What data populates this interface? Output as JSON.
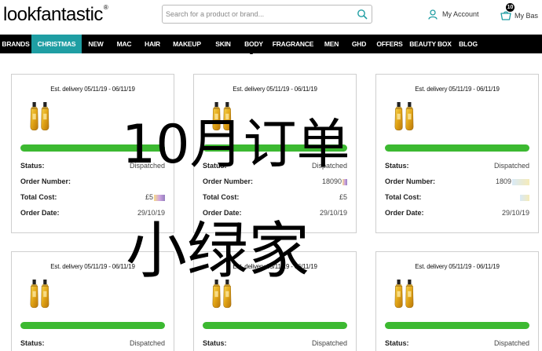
{
  "brand": {
    "logo_text": "lookfantastic",
    "logo_mark": "®"
  },
  "search": {
    "placeholder": "Search for a product or brand..."
  },
  "account": {
    "label": "My Account"
  },
  "basket": {
    "label": "My Bas",
    "count": "10"
  },
  "nav": {
    "items": [
      {
        "label": "BRANDS",
        "active": false
      },
      {
        "label": "CHRISTMAS",
        "active": true
      },
      {
        "label": "NEW",
        "active": false
      },
      {
        "label": "MAC",
        "active": false
      },
      {
        "label": "HAIR",
        "active": false
      },
      {
        "label": "MAKEUP",
        "active": false
      },
      {
        "label": "SKIN",
        "active": false
      },
      {
        "label": "BODY",
        "active": false
      },
      {
        "label": "FRAGRANCE",
        "active": false
      },
      {
        "label": "MEN",
        "active": false
      },
      {
        "label": "GHD",
        "active": false
      },
      {
        "label": "OFFERS",
        "active": false
      },
      {
        "label": "BEAUTY BOX",
        "active": false
      },
      {
        "label": "BLOG",
        "active": false
      }
    ]
  },
  "labels": {
    "status": "Status:",
    "order_number": "Order Number:",
    "total_cost": "Total Cost:",
    "order_date": "Order Date:"
  },
  "orders": [
    {
      "delivery": "Est. delivery 05/11/19 - 06/11/19",
      "status": "Dispatched",
      "order_number": "",
      "total_cost": "£5",
      "order_date": "29/10/19"
    },
    {
      "delivery": "Est. delivery 05/11/19 - 06/11/19",
      "status": "Dispatched",
      "order_number": "18090",
      "total_cost": "£5",
      "order_date": "29/10/19"
    },
    {
      "delivery": "Est. delivery 05/11/19 - 06/11/19",
      "status": "Dispatched",
      "order_number": "1809",
      "total_cost": "",
      "order_date": "29/10/19"
    },
    {
      "delivery": "Est. delivery 05/11/19 - 06/11/19",
      "status": "Dispatched"
    },
    {
      "delivery": "Est. delivery 05/11/19 - 06/11/19",
      "status": "Dispatched"
    },
    {
      "delivery": "Est. delivery 05/11/19 - 06/11/19",
      "status": "Dispatched"
    }
  ],
  "overlay": {
    "line1": "10月订单",
    "line2": "小绿家"
  },
  "colors": {
    "accent": "#1f9ea3",
    "progress": "#3cb931",
    "nav_bg": "#000000"
  },
  "icons": {
    "search": "search-icon",
    "account": "user-icon",
    "basket": "basket-icon",
    "product": "hair-oil-bottles-icon"
  }
}
